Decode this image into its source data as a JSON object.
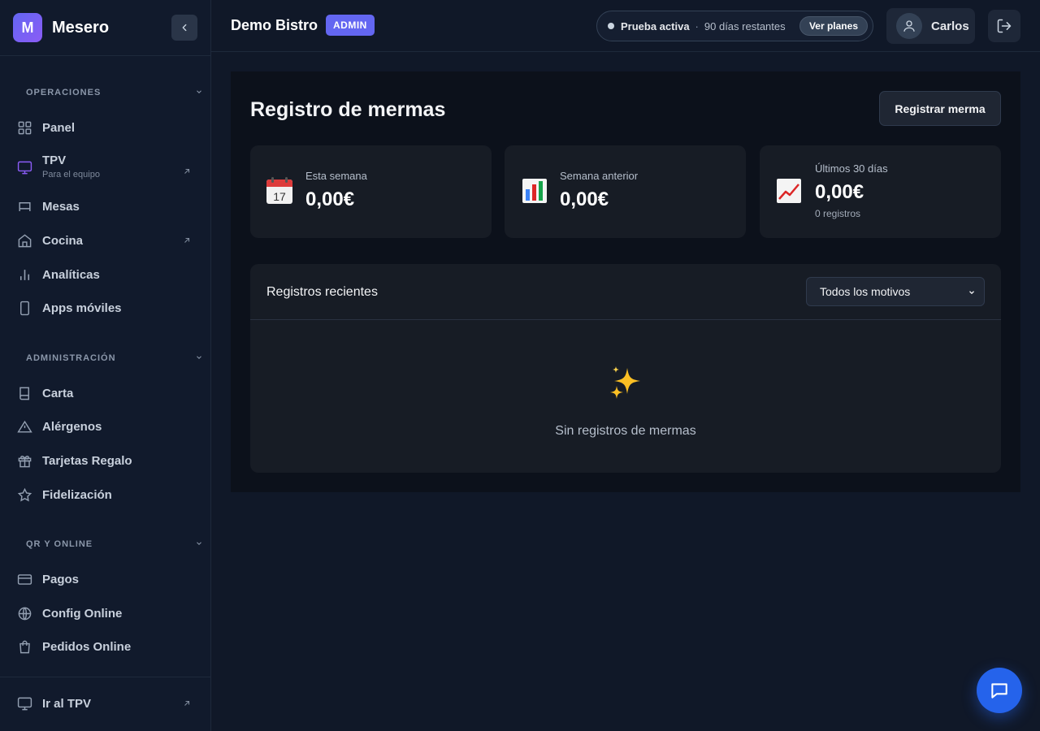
{
  "app": {
    "logo_letter": "M",
    "name": "Mesero"
  },
  "sidebar": {
    "sections": [
      {
        "title": "OPERACIONES",
        "items": [
          {
            "label": "Panel",
            "icon": "grid-icon"
          },
          {
            "label": "TPV",
            "sublabel": "Para el equipo",
            "icon": "monitor-icon",
            "external": true,
            "accent": "#8b5cf6"
          },
          {
            "label": "Mesas",
            "icon": "table-icon"
          },
          {
            "label": "Cocina",
            "icon": "home-icon",
            "external": true
          },
          {
            "label": "Analíticas",
            "icon": "bar-chart-icon"
          },
          {
            "label": "Apps móviles",
            "icon": "smartphone-icon"
          }
        ]
      },
      {
        "title": "ADMINISTRACIÓN",
        "items": [
          {
            "label": "Carta",
            "icon": "book-icon"
          },
          {
            "label": "Alérgenos",
            "icon": "warning-icon"
          },
          {
            "label": "Tarjetas Regalo",
            "icon": "gift-icon"
          },
          {
            "label": "Fidelización",
            "icon": "star-icon"
          }
        ]
      },
      {
        "title": "QR Y ONLINE",
        "items": [
          {
            "label": "Pagos",
            "icon": "credit-card-icon"
          },
          {
            "label": "Config Online",
            "icon": "globe-icon"
          },
          {
            "label": "Pedidos Online",
            "icon": "shopping-bag-icon"
          }
        ]
      }
    ],
    "footer": {
      "label": "Ir al TPV",
      "icon": "monitor-icon",
      "external": true
    }
  },
  "topbar": {
    "org_name": "Demo Bistro",
    "role_badge": "ADMIN",
    "trial": {
      "status": "Prueba activa",
      "separator": "·",
      "days": "90 días restantes",
      "plans_button": "Ver planes"
    },
    "user_name": "Carlos"
  },
  "main": {
    "title": "Registro de mermas",
    "primary_button": "Registrar merma",
    "stats": [
      {
        "label": "Esta semana",
        "value": "0,00€",
        "emoji": "calendar-icon"
      },
      {
        "label": "Semana anterior",
        "value": "0,00€",
        "emoji": "bar-chart-emoji-icon"
      },
      {
        "label": "Últimos 30 días",
        "value": "0,00€",
        "sub": "0 registros",
        "emoji": "trend-up-icon"
      }
    ],
    "records": {
      "title": "Registros recientes",
      "filter": {
        "selected": "Todos los motivos"
      },
      "empty_text": "Sin registros de mermas",
      "empty_icon": "sparkles-icon"
    }
  },
  "colors": {
    "brand": "#6366f1",
    "accent_tpv": "#8b5cf6",
    "chat_fab": "#2563eb"
  }
}
